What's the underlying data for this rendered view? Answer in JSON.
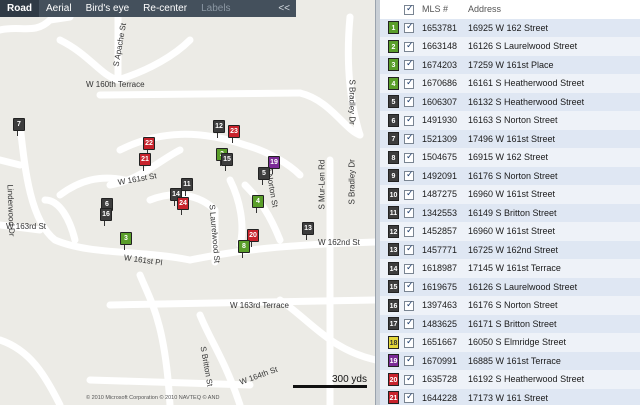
{
  "toolbar": {
    "road": "Road",
    "aerial": "Aerial",
    "birds_eye": "Bird's eye",
    "recenter": "Re-center",
    "labels": "Labels",
    "collapse": "<<"
  },
  "streets": [
    "S Apache St",
    "W 160th Terrace",
    "S Bradley Dr",
    "Linderwood Dr",
    "W 161st St",
    "S Laurelwood St",
    "S Norton St",
    "S Mur-Len Rd",
    "S Bradley Dr",
    "W 163rd St",
    "W 161st Pl",
    "W 162nd St",
    "W 163rd Terrace",
    "S Britton St",
    "W 164th St"
  ],
  "scale_label": "300 yds",
  "copyright": "© 2010 Microsoft Corporation   © 2010 NAVTEQ   © AND",
  "markers": [
    {
      "n": "7",
      "color": "black"
    },
    {
      "n": "12",
      "color": "black"
    },
    {
      "n": "23",
      "color": "red"
    },
    {
      "n": "22",
      "color": "red"
    },
    {
      "n": "21",
      "color": "red"
    },
    {
      "n": "2",
      "color": "green"
    },
    {
      "n": "15",
      "color": "black"
    },
    {
      "n": "19",
      "color": "purple"
    },
    {
      "n": "5",
      "color": "black"
    },
    {
      "n": "11",
      "color": "black"
    },
    {
      "n": "14",
      "color": "black"
    },
    {
      "n": "24",
      "color": "red"
    },
    {
      "n": "4",
      "color": "green"
    },
    {
      "n": "6",
      "color": "black"
    },
    {
      "n": "16",
      "color": "black"
    },
    {
      "n": "3",
      "color": "green"
    },
    {
      "n": "13",
      "color": "black"
    },
    {
      "n": "20",
      "color": "red"
    },
    {
      "n": "8",
      "color": "green"
    }
  ],
  "table": {
    "headers": {
      "mls": "MLS #",
      "address": "Address"
    },
    "rows": [
      {
        "n": "1",
        "color": "green",
        "mls": "1653781",
        "address": "16925 W 162 Street"
      },
      {
        "n": "2",
        "color": "green",
        "mls": "1663148",
        "address": "16126 S Laurelwood Street"
      },
      {
        "n": "3",
        "color": "green",
        "mls": "1674203",
        "address": "17259 W 161st Place"
      },
      {
        "n": "4",
        "color": "green",
        "mls": "1670686",
        "address": "16161 S Heatherwood Street"
      },
      {
        "n": "5",
        "color": "black",
        "mls": "1606307",
        "address": "16132 S Heatherwood Street"
      },
      {
        "n": "6",
        "color": "black",
        "mls": "1491930",
        "address": "16163 S Norton Street"
      },
      {
        "n": "7",
        "color": "black",
        "mls": "1521309",
        "address": "17496 W 161st Street"
      },
      {
        "n": "8",
        "color": "black",
        "mls": "1504675",
        "address": "16915 W 162 Street"
      },
      {
        "n": "9",
        "color": "black",
        "mls": "1492091",
        "address": "16176 S Norton Street"
      },
      {
        "n": "10",
        "color": "black",
        "mls": "1487275",
        "address": "16960 W 161st Street"
      },
      {
        "n": "11",
        "color": "black",
        "mls": "1342553",
        "address": "16149 S Britton Street"
      },
      {
        "n": "12",
        "color": "black",
        "mls": "1452857",
        "address": "16960 W 161st Street"
      },
      {
        "n": "13",
        "color": "black",
        "mls": "1457771",
        "address": "16725 W 162nd Street"
      },
      {
        "n": "14",
        "color": "black",
        "mls": "1618987",
        "address": "17145 W 161st Terrace"
      },
      {
        "n": "15",
        "color": "black",
        "mls": "1619675",
        "address": "16126 S Laurelwood Street"
      },
      {
        "n": "16",
        "color": "black",
        "mls": "1397463",
        "address": "16176 S Norton Street"
      },
      {
        "n": "17",
        "color": "black",
        "mls": "1483625",
        "address": "16171 S Britton Street"
      },
      {
        "n": "18",
        "color": "yellow",
        "mls": "1651667",
        "address": "16050 S Elmridge Street"
      },
      {
        "n": "19",
        "color": "purple",
        "mls": "1670991",
        "address": "16885 W 161st Terrace"
      },
      {
        "n": "20",
        "color": "red",
        "mls": "1635728",
        "address": "16192 S Heatherwood Street"
      },
      {
        "n": "21",
        "color": "red",
        "mls": "1644228",
        "address": "17173 W 161 Street"
      }
    ]
  },
  "colors": {
    "toolbar": "#44505c",
    "map_bg": "#ecebe6",
    "row_odd": "#dfe7f3",
    "row_even": "#eef2f8"
  }
}
